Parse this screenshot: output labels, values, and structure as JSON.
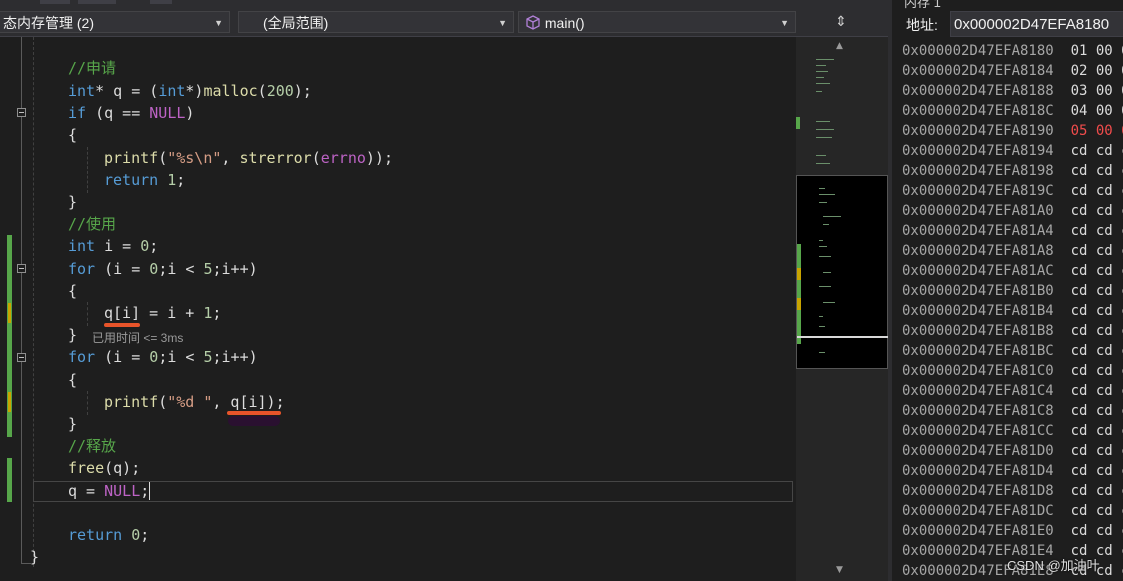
{
  "nav": {
    "project_combo": "态内存管理 (2)",
    "scope_combo": "(全局范围)",
    "function_combo": "main()"
  },
  "code": {
    "line_comment_apply": "//申请",
    "line_malloc": {
      "type": "int",
      "rest_a": "* q = (",
      "cast": "int",
      "rest_b": "*)",
      "fn": "malloc",
      "arg": "200",
      "end": ");"
    },
    "line_if": {
      "kw": "if",
      "rest": " (q == ",
      "null": "NULL",
      "end": ")"
    },
    "brace_open": "{",
    "line_printf_err": {
      "fn": "printf",
      "str": "\"%s\\n\"",
      "mid": ", ",
      "fn2": "strerror",
      "var": "errno",
      "end": "));"
    },
    "line_return1": {
      "kw": "return",
      "num": "1",
      "end": ";"
    },
    "brace_close": "}",
    "line_comment_use": "//使用",
    "line_int_i": {
      "kw": "int",
      "rest": " i = ",
      "num": "0",
      "end": ";"
    },
    "line_for": {
      "kw": "for",
      "rest_a": " (i = ",
      "n0": "0",
      "rest_b": ";i < ",
      "n5": "5",
      "end": ";i++)"
    },
    "line_assign": {
      "code": "q[i] = i + ",
      "num": "1",
      "end": ";"
    },
    "perf_hint": "已用时间 <= 3ms",
    "line_printf_d": {
      "fn": "printf",
      "open": "(",
      "str": "\"%d \"",
      "mid": ", q[i]);"
    },
    "line_comment_free": "//释放",
    "line_free": {
      "fn": "free",
      "rest": "(q);"
    },
    "line_null": {
      "rest": "q = ",
      "null": "NULL",
      "end": ";"
    },
    "line_return0": {
      "kw": "return",
      "num": "0",
      "end": ";"
    }
  },
  "memory": {
    "title": "内存 1",
    "address_label": "地址:",
    "address_value": "0x000002D47EFA8180",
    "rows": [
      {
        "addr": "0x000002D47EFA8180",
        "bytes": "01 00 00",
        "changed": false
      },
      {
        "addr": "0x000002D47EFA8184",
        "bytes": "02 00 00",
        "changed": false
      },
      {
        "addr": "0x000002D47EFA8188",
        "bytes": "03 00 00",
        "changed": false
      },
      {
        "addr": "0x000002D47EFA818C",
        "bytes": "04 00 00",
        "changed": false
      },
      {
        "addr": "0x000002D47EFA8190",
        "bytes": "05 00 00",
        "changed": true
      },
      {
        "addr": "0x000002D47EFA8194",
        "bytes": "cd cd cd",
        "changed": false
      },
      {
        "addr": "0x000002D47EFA8198",
        "bytes": "cd cd cd",
        "changed": false
      },
      {
        "addr": "0x000002D47EFA819C",
        "bytes": "cd cd cd",
        "changed": false
      },
      {
        "addr": "0x000002D47EFA81A0",
        "bytes": "cd cd cd",
        "changed": false
      },
      {
        "addr": "0x000002D47EFA81A4",
        "bytes": "cd cd cd",
        "changed": false
      },
      {
        "addr": "0x000002D47EFA81A8",
        "bytes": "cd cd cd",
        "changed": false
      },
      {
        "addr": "0x000002D47EFA81AC",
        "bytes": "cd cd cd",
        "changed": false
      },
      {
        "addr": "0x000002D47EFA81B0",
        "bytes": "cd cd cd",
        "changed": false
      },
      {
        "addr": "0x000002D47EFA81B4",
        "bytes": "cd cd cd",
        "changed": false
      },
      {
        "addr": "0x000002D47EFA81B8",
        "bytes": "cd cd cd",
        "changed": false
      },
      {
        "addr": "0x000002D47EFA81BC",
        "bytes": "cd cd cd",
        "changed": false
      },
      {
        "addr": "0x000002D47EFA81C0",
        "bytes": "cd cd cd",
        "changed": false
      },
      {
        "addr": "0x000002D47EFA81C4",
        "bytes": "cd cd cd",
        "changed": false
      },
      {
        "addr": "0x000002D47EFA81C8",
        "bytes": "cd cd cd",
        "changed": false
      },
      {
        "addr": "0x000002D47EFA81CC",
        "bytes": "cd cd cd",
        "changed": false
      },
      {
        "addr": "0x000002D47EFA81D0",
        "bytes": "cd cd cd",
        "changed": false
      },
      {
        "addr": "0x000002D47EFA81D4",
        "bytes": "cd cd cd",
        "changed": false
      },
      {
        "addr": "0x000002D47EFA81D8",
        "bytes": "cd cd cd",
        "changed": false
      },
      {
        "addr": "0x000002D47EFA81DC",
        "bytes": "cd cd cd",
        "changed": false
      },
      {
        "addr": "0x000002D47EFA81E0",
        "bytes": "cd cd cd",
        "changed": false
      },
      {
        "addr": "0x000002D47EFA81E4",
        "bytes": "cd cd cd",
        "changed": false
      },
      {
        "addr": "0x000002D47EFA81E8",
        "bytes": "cd cd cd",
        "changed": false
      }
    ]
  },
  "watermark": "CSDN @加油叶"
}
